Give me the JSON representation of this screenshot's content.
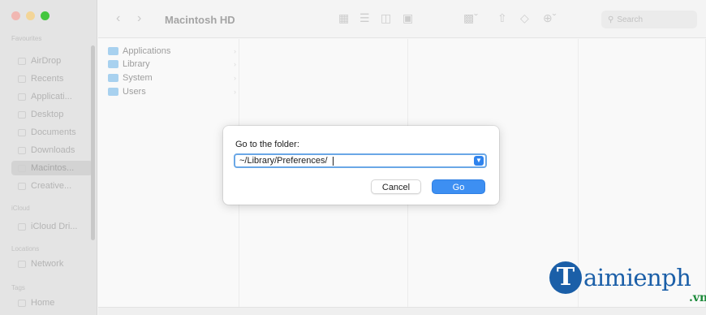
{
  "window": {
    "title": "Macintosh HD",
    "search_placeholder": "Search"
  },
  "sidebar": {
    "sections": {
      "favourites": "Favourites",
      "icloud": "iCloud",
      "locations": "Locations",
      "tags": "Tags"
    },
    "favourites": [
      "AirDrop",
      "Recents",
      "Applicati...",
      "Desktop",
      "Documents",
      "Downloads",
      "Macintos...",
      "Creative..."
    ],
    "icloud": [
      "iCloud Dri..."
    ],
    "locations": [
      "Network"
    ],
    "tags": [
      "Home"
    ],
    "selected": "Macintos..."
  },
  "columns": {
    "first": [
      "Applications",
      "Library",
      "System",
      "Users"
    ]
  },
  "dialog": {
    "label": "Go to the folder:",
    "path_value": "~/Library/Preferences/",
    "cancel_label": "Cancel",
    "go_label": "Go"
  },
  "watermark": {
    "brand": "aimienph",
    "logo_letter": "T",
    "suffix": ".vn"
  },
  "colors": {
    "accent": "#3d8ff2",
    "folder": "#a8d1ef",
    "watermark_blue": "#1b5fa8",
    "watermark_green": "#1c8a3a"
  }
}
